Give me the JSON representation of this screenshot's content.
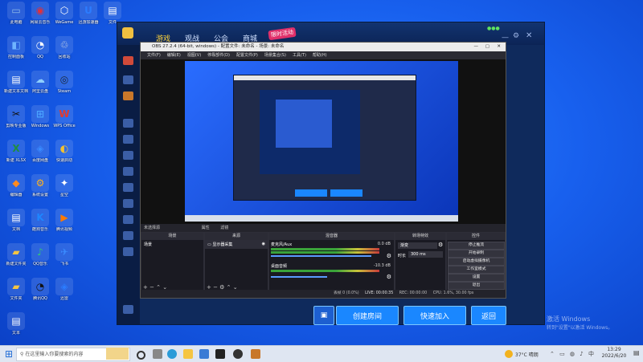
{
  "desktop": {
    "icons": [
      {
        "label": "此电脑",
        "glyph": "▭",
        "color": "#8fb9e8"
      },
      {
        "label": "网易云音乐",
        "glyph": "◉",
        "color": "#e0303a"
      },
      {
        "label": "WeGame",
        "glyph": "⬡",
        "color": "#ffffff"
      },
      {
        "label": "迅游加速器",
        "glyph": "U",
        "color": "#2b7cff"
      },
      {
        "label": "文件",
        "glyph": "▤",
        "color": "#ffffff"
      },
      {
        "label": "控制面板",
        "glyph": "◧",
        "color": "#6fb4ff"
      },
      {
        "label": "QQ",
        "glyph": "◔",
        "color": "#ffffff"
      },
      {
        "label": "回收站",
        "glyph": "♲",
        "color": "#cfd8e6"
      },
      {
        "label": "新建文本文档",
        "glyph": "▤",
        "color": "#ffffff"
      },
      {
        "label": "阿里云盘",
        "glyph": "☁",
        "color": "#8fd0ff"
      },
      {
        "label": "Steam",
        "glyph": "◎",
        "color": "#1b2838"
      },
      {
        "label": "剪映专业版",
        "glyph": "✂",
        "color": "#111111"
      },
      {
        "label": "Windows",
        "glyph": "⊞",
        "color": "#4aa3ff"
      },
      {
        "label": "WPS Office",
        "glyph": "W",
        "color": "#e23a2e"
      },
      {
        "label": "新建 XLSX",
        "glyph": "X",
        "color": "#1e8e3e"
      },
      {
        "label": "百度网盘",
        "glyph": "◈",
        "color": "#3a8bff"
      },
      {
        "label": "快速启动",
        "glyph": "◐",
        "color": "#f2c230"
      },
      {
        "label": "编辑器",
        "glyph": "◆",
        "color": "#ff8a1f"
      },
      {
        "label": "系统设置",
        "glyph": "⚙",
        "color": "#ffb21f"
      },
      {
        "label": "星空",
        "glyph": "✦",
        "color": "#ffffff"
      },
      {
        "label": "文档",
        "glyph": "▤",
        "color": "#ffffff"
      },
      {
        "label": "酷狗音乐",
        "glyph": "K",
        "color": "#1e86ff"
      },
      {
        "label": "腾讯视频",
        "glyph": "▶",
        "color": "#ff7a00"
      },
      {
        "label": "新建文件夹",
        "glyph": "▰",
        "color": "#f5c542"
      },
      {
        "label": "QQ音乐",
        "glyph": "♪",
        "color": "#31c27c"
      },
      {
        "label": "飞书",
        "glyph": "✈",
        "color": "#3a8bff"
      },
      {
        "label": "文件夹",
        "glyph": "▰",
        "color": "#f5c542"
      },
      {
        "label": "腾讯QQ",
        "glyph": "◔",
        "color": "#111111"
      },
      {
        "label": "迅雷",
        "glyph": "◈",
        "color": "#2b7cff"
      },
      {
        "label": "文本",
        "glyph": "▤",
        "color": "#ffffff"
      }
    ],
    "watermark_line1": "激活 Windows",
    "watermark_line2": "转到\"设置\"以激活 Windows。"
  },
  "game": {
    "tabs": [
      "游戏",
      "观战",
      "公会",
      "商城"
    ],
    "badge": "限时活动",
    "bottom_buttons": {
      "create": "创建房间",
      "quick_join": "快速加入",
      "back": "返回"
    },
    "signal": "●●●"
  },
  "obs": {
    "title": "OBS 27.2.4 (64-bit, windows) - 配置文件: 未命名 - 场景: 未命名",
    "menu": [
      "文件(F)",
      "编辑(E)",
      "视图(V)",
      "停靠部件(D)",
      "配置文件(P)",
      "场景集合(S)",
      "工具(T)",
      "帮助(H)"
    ],
    "no_source": "未选择源",
    "properties_label": "属性",
    "filters_label": "滤镜",
    "docks": {
      "scenes": {
        "header": "场景",
        "items": [
          "场景"
        ]
      },
      "sources": {
        "header": "来源",
        "items": [
          "显示器采集"
        ]
      },
      "mixer": {
        "header": "混音器",
        "tracks": [
          {
            "name": "麦克风/Aux",
            "db": "0.0 dB"
          },
          {
            "name": "桌面音频",
            "db": "-10.3 dB"
          }
        ]
      },
      "transitions": {
        "header": "转场特效",
        "mode": "渐变",
        "duration_label": "时长",
        "duration": "300 ms"
      },
      "controls": {
        "header": "控件",
        "buttons": [
          "停止推流",
          "开始录制",
          "启动虚拟摄像机",
          "工作室模式",
          "设置",
          "退出"
        ]
      }
    },
    "status": {
      "live": "LIVE: 00:00:35",
      "rec": "REC: 00:00:00",
      "cpu": "CPU: 1.6%, 30.00 fps",
      "frames": "丢帧 0 (0.0%)"
    }
  },
  "taskbar": {
    "search_placeholder": "在这里输入你要搜索的内容",
    "weather": "37°C 晴朗",
    "time": "13:29",
    "date": "2022/6/20"
  }
}
